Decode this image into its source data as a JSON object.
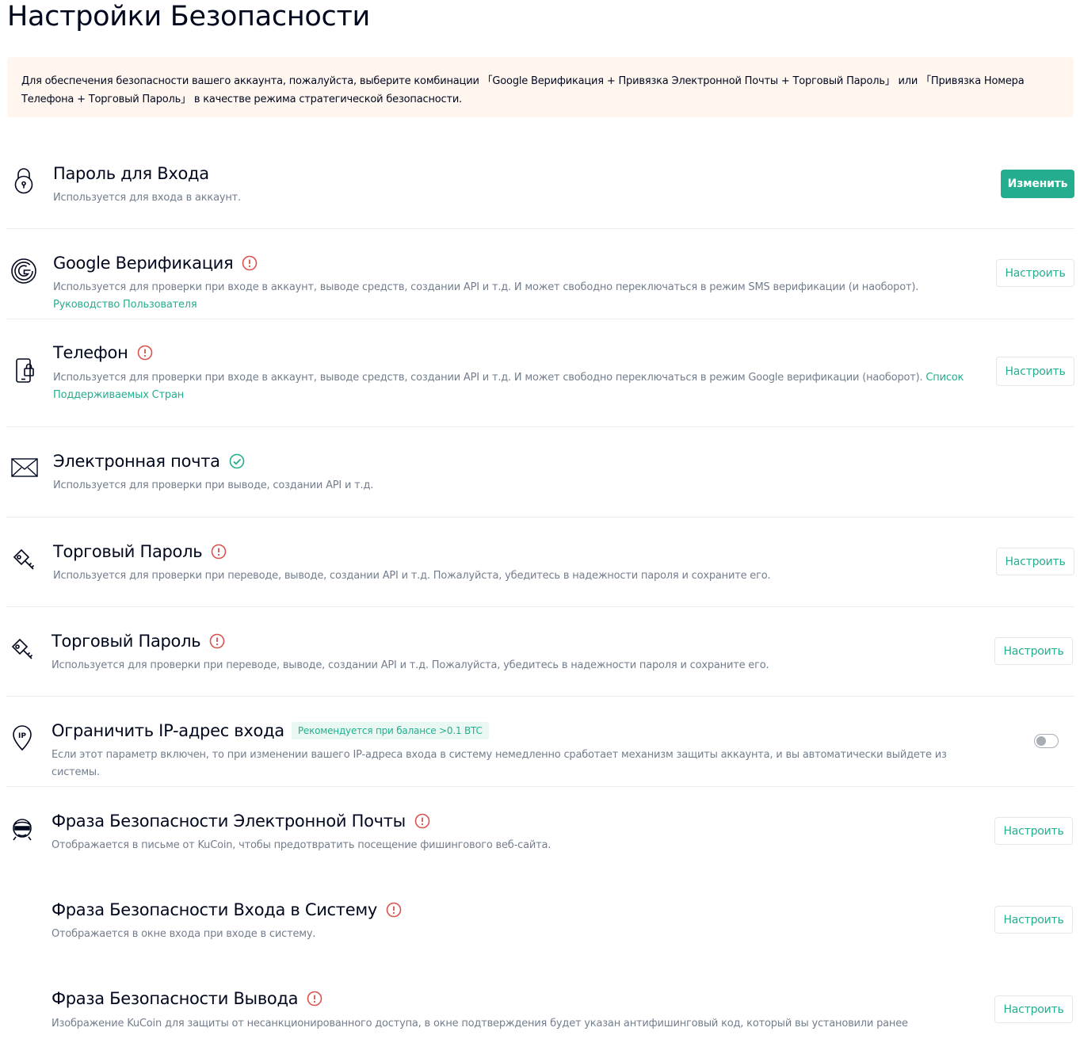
{
  "page_title": "Настройки Безопасности",
  "notice": "Для обеспечения безопасности вашего аккаунта, пожалуйста, выберите комбинации 「Google Верификация + Привязка Электронной Почты + Торговый Пароль」 или 「Привязка Номера Телефона + Торговый Пароль」 в качестве режима стратегической безопасности.",
  "colors": {
    "accent": "#24ae8f",
    "warning": "#d9534f",
    "notice_bg": "#fff6f0"
  },
  "items": [
    {
      "icon": "lock-icon",
      "title": "Пароль для Входа",
      "status": "none",
      "desc": "Используется для входа в аккаунт.",
      "link": "",
      "action": "Изменить",
      "action_type": "primary"
    },
    {
      "icon": "google-icon",
      "title": "Google Верификация",
      "status": "warning",
      "desc": "Используется для проверки при входе в аккаунт, выводе средств, создании API и т.д. И может свободно переключаться в режим SMS верификации (и наоборот).",
      "link": "Руководство Пользователя",
      "action": "Настроить",
      "action_type": "outline"
    },
    {
      "icon": "phone-lock-icon",
      "title": "Телефон",
      "status": "warning",
      "desc": "Используется для проверки при входе в аккаунт, выводе средств, создании API и т.д. И может свободно переключаться в режим Google верификации (наоборот).",
      "link": "Список Поддерживаемых Стран",
      "action": "Настроить",
      "action_type": "outline"
    },
    {
      "icon": "envelope-icon",
      "title": "Электронная почта",
      "status": "verified",
      "desc": "Используется для проверки при выводе, создании API и т.д.",
      "link": "",
      "action": "",
      "action_type": "none"
    },
    {
      "icon": "key-icon",
      "title": "Торговый Пароль",
      "status": "warning",
      "desc": "Используется для проверки при переводе, выводе, создании API и т.д. Пожалуйста, убедитесь в надежности пароля и сохраните его.",
      "link": "",
      "action": "Настроить",
      "action_type": "outline"
    },
    {
      "icon": "key-icon",
      "title": "Торговый Пароль",
      "status": "warning",
      "desc": "Используется для проверки при переводе, выводе, создании API и т.д. Пожалуйста, убедитесь в надежности пароля и сохраните его.",
      "link": "",
      "action": "Настроить",
      "action_type": "outline"
    },
    {
      "icon": "ip-location-icon",
      "title": "Ограничить IP-адрес входа",
      "status": "none",
      "badge": "Рекомендуется при балансе >0.1 BTC",
      "desc": "Если этот параметр включен, то при изменении вашего IP-адреса входа в систему немедленно сработает механизм защиты аккаунта, и вы автоматически выйдете из системы.",
      "link": "",
      "action": "",
      "action_type": "toggle",
      "toggle_on": false
    },
    {
      "icon": "anti-phishing-icon",
      "title": "Фраза Безопасности Электронной Почты",
      "status": "warning",
      "desc": "Отображается в письме от KuCoin, чтобы предотвратить посещение фишингового веб-сайта.",
      "link": "",
      "action": "Настроить",
      "action_type": "outline"
    },
    {
      "icon": "",
      "title": "Фраза Безопасности Входа в Систему",
      "status": "warning",
      "desc": "Отображается в окне входа при входе в систему.",
      "link": "",
      "action": "Настроить",
      "action_type": "outline"
    },
    {
      "icon": "",
      "title": "Фраза Безопасности Вывода",
      "status": "warning",
      "desc": "Изображение KuCoin для защиты от несанкционированного доступа, в окне подтверждения будет указан антифишинговый код, который вы установили ранее",
      "link": "",
      "action": "Настроить",
      "action_type": "outline"
    }
  ]
}
